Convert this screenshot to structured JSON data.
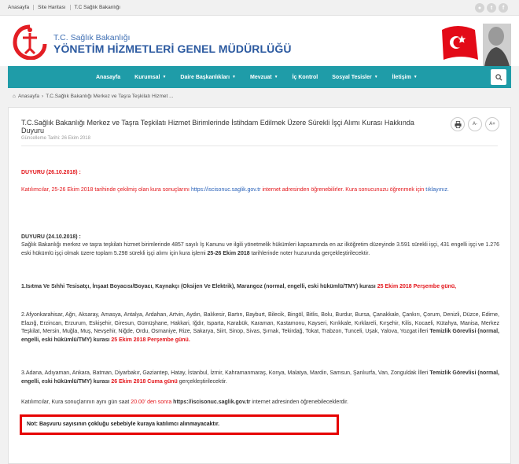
{
  "topbar": {
    "links": [
      "Anasayfa",
      "Site Haritası",
      "T.C Sağlık Bakanlığı"
    ],
    "social_icons": [
      "flickr-icon",
      "twitter-icon",
      "facebook-icon"
    ]
  },
  "header": {
    "ministry": "T.C. Sağlık Bakanlığı",
    "directorate": "YÖNETİM HİZMETLERİ GENEL MÜDÜRLÜĞÜ"
  },
  "nav": {
    "items": [
      {
        "label": "Anasayfa",
        "dropdown": false
      },
      {
        "label": "Kurumsal",
        "dropdown": true
      },
      {
        "label": "Daire Başkanlıkları",
        "dropdown": true
      },
      {
        "label": "Mevzuat",
        "dropdown": true
      },
      {
        "label": "İç Kontrol",
        "dropdown": false
      },
      {
        "label": "Sosyal Tesisler",
        "dropdown": true
      },
      {
        "label": "İletişim",
        "dropdown": true
      }
    ],
    "search_icon": "search-icon"
  },
  "breadcrumb": {
    "home": "Anasayfa",
    "current": "T.C.Sağlık Bakanlığı Merkez ve Taşra Teşkilatı Hizmet ..."
  },
  "article": {
    "title": "T.C.Sağlık Bakanlığı Merkez ve Taşra Teşkilatı Hizmet Birimlerinde İstihdam Edilmek Üzere Sürekli İşçi Alımı Kurası Hakkında Duyuru",
    "updated": "Güncelleme Tarihi: 26 Ekim 2018",
    "tools": [
      "print-icon",
      "A-",
      "A+"
    ],
    "duyuru1_heading": "DUYURU (26.10.2018) :",
    "duyuru1_text_a": "Katılımcılar, 25-26 Ekim 2018 tarihinde çekilmiş olan kura sonuçlarını ",
    "duyuru1_link": "https://iscisonuc.saglik.gov.tr",
    "duyuru1_text_b": " internet adresinden öğrenebilirler. Kura sonucunuzu öğrenmek için ",
    "duyuru1_link2": "tıklayınız.",
    "duyuru2_heading": "DUYURU (24.10.2018) :",
    "duyuru2_text_a": "Sağlık Bakanlığı merkez ve taşra teşkilatı hizmet birimlerinde 4857 sayılı İş Kanunu ve ilgili yönetmelik hükümleri kapsamında en az ilköğretim düzeyinde 3.591 sürekli işçi, 431 engelli işçi ve 1.276 eski hükümlü işçi olmak üzere toplam 5.298 sürekli işçi alımı için kura işlemi ",
    "duyuru2_bold": "25-26 Ekim 2018",
    "duyuru2_text_b": " tarihlerinde noter huzurunda gerçekleştirilecektir.",
    "item1_text": "1.Isıtma Ve Sıhhi Tesisatçı, İnşaat Boyacısı/Boyacı, Kaynakçı (Oksijen Ve Elektrik), Marangoz (normal, engelli, eski hükümlü/TMY) kurası ",
    "item1_date": "25 Ekim 2018 Perşembe günü,",
    "item2_text": "2.Afyonkarahisar, Ağrı, Aksaray, Amasya, Antalya, Ardahan, Artvin, Aydın, Balıkesir, Bartın, Bayburt, Bilecik, Bingöl, Bitlis, Bolu, Burdur, Bursa, Çanakkale, Çankırı, Çorum, Denizli, Düzce, Edirne, Elazığ, Erzincan, Erzurum, Eskişehir, Giresun, Gümüşhane, Hakkari, Iğdır, Isparta, Karabük, Karaman, Kastamonu, Kayseri, Kırıkkale, Kırklareli, Kırşehir, Kilis, Kocaeli, Kütahya, Manisa, Merkez Teşkilat, Mersin, Muğla, Muş, Nevşehir, Niğde, Ordu, Osmaniye, Rize, Sakarya, Siirt, Sinop, Sivas, Şırnak, Tekirdağ, Tokat, Trabzon, Tunceli, Uşak, Yalova, Yozgat illeri ",
    "item2_bold": "Temizlik Görevlisi (normal, engelli, eski hükümlü/TMY) kurası ",
    "item2_date": "25 Ekim 2018 Perşembe günü.",
    "item3_text": "3.Adana, Adıyaman, Ankara, Batman, Diyarbakır, Gaziantep, Hatay, İstanbul, İzmir, Kahramanmaraş, Konya, Malatya, Mardin, Samsun, Şanlıurfa, Van, Zonguldak İlleri ",
    "item3_bold": "Temizlik Görevlisi  (normal, engelli, eski hükümlü/TMY) kurası ",
    "item3_date": "26 Ekim 2018 Cuma günü",
    "item3_end": " gerçekleştirilecektir.",
    "results_text_a": "Katılımcılar, Kura sonuçlarının aynı gün saat ",
    "results_time": "20.00' den sonra",
    "results_bold": " https://iscisonuc.saglik.gov.tr",
    "results_text_b": " internet adresinden öğrenebileceklerdir.",
    "note": "Not: Başvuru sayısının çokluğu sebebiyle kuraya katılımcı alınmayacaktır."
  },
  "colors": {
    "nav_bg": "#1f9ca8",
    "accent_red": "#e3151a",
    "link_blue": "#2a62b9",
    "header_blue": "#2c5aa0"
  }
}
